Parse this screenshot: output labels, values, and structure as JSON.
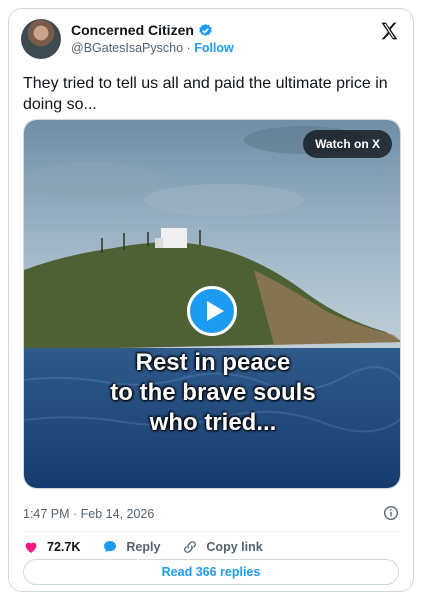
{
  "author": {
    "display_name": "Concerned Citizen",
    "handle": "@BGatesIsaPyscho",
    "separator": "·",
    "follow_label": "Follow",
    "verified_color": "#1d9bf0"
  },
  "tweet": {
    "text": "They tried to tell us all and paid the ultimate price in doing so...",
    "timestamp": "1:47 PM · Feb 14, 2026"
  },
  "media": {
    "watch_label": "Watch on X",
    "caption_lines": [
      "Rest in peace",
      "to the brave souls",
      "who tried..."
    ]
  },
  "actions": {
    "likes": "72.7K",
    "reply_label": "Reply",
    "copy_label": "Copy link"
  },
  "replies_button": "Read 366 replies",
  "icons": [
    "verified-badge-icon",
    "x-logo-icon",
    "play-icon",
    "info-icon",
    "heart-icon",
    "reply-bubble-icon",
    "link-icon"
  ],
  "colors": {
    "accent": "#1d9bf0",
    "like": "#f91880",
    "muted": "#536471"
  }
}
